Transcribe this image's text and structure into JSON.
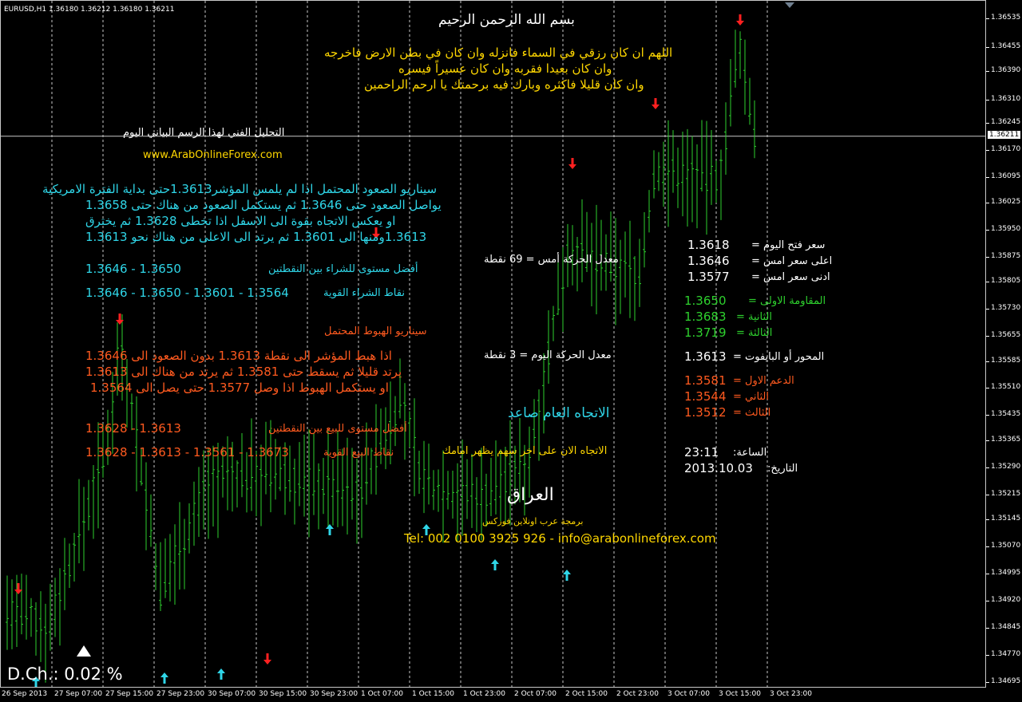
{
  "symbol_label": "EURUSD,H1  1.36180 1.36212 1.36180 1.36211",
  "current_price_label": "1.36211",
  "dch_label": "D.Ch.: 0.02 %",
  "colors": {
    "bg": "#000000",
    "candle": "#2ed12e",
    "grid": "#c8c8c8",
    "sell_arrow": "#ff2020",
    "buy_arrow": "#2fd6e8"
  },
  "chart_data": {
    "type": "candlestick",
    "title": "",
    "symbol": "EURUSD",
    "timeframe": "H1",
    "ylim": [
      1.3469,
      1.3656
    ],
    "y_ticks": [
      "1.36535",
      "1.36455",
      "1.36390",
      "1.36310",
      "1.36245",
      "1.36170",
      "1.36095",
      "1.36025",
      "1.35950",
      "1.35875",
      "1.35805",
      "1.35730",
      "1.35655",
      "1.35585",
      "1.35510",
      "1.35435",
      "1.35365",
      "1.35290",
      "1.35215",
      "1.35145",
      "1.35070",
      "1.34995",
      "1.34920",
      "1.34845",
      "1.34770",
      "1.34695"
    ],
    "x_ticks": [
      "26 Sep 2013",
      "27 Sep 07:00",
      "27 Sep 15:00",
      "27 Sep 23:00",
      "30 Sep 07:00",
      "30 Sep 15:00",
      "30 Sep 23:00",
      "1 Oct 07:00",
      "1 Oct 15:00",
      "1 Oct 23:00",
      "2 Oct 07:00",
      "2 Oct 15:00",
      "2 Oct 23:00",
      "3 Oct 07:00",
      "3 Oct 15:00",
      "3 Oct 23:00"
    ],
    "last_close": 1.36211,
    "grid": true,
    "sell_arrow_count": 7,
    "buy_arrow_count": 8
  },
  "texts": {
    "basmala": "بسم الله الرحمن الرحيم",
    "dua1": "اللهم ان كان رزقي في السماء فانزله وان كان في بطن الارض فاخرجه",
    "dua2": "وان كان بعيدا فقربه وان كان عسيراً فيسره",
    "dua3": "وان كان قليلا فاكثره وبارك فيه برحمتك يا ارحم الراحمين",
    "analysis_title": "التحليل الفني لهذا الرسم البياني اليوم",
    "website": "www.ArabOnlineForex.com",
    "up_line1": "سيناريو الصعود المحتمل      اذا لم يلمس المؤشر1.3613حتى بداية الفترة الامريكية",
    "up_line2": "يواصل الصعود حتى 1.3646 ثم يستكمل الصعود من هناك حتى 1.3658",
    "up_line3": "او يعكس الاتجاه بقوة الى الاسفل اذا تخطى 1.3628 ثم يخترق",
    "up_line4": "1.3613ومنها الى 1.3601 ثم يرتد الى الاعلى من هناك نحو 1.3613",
    "best_buy_label": "أفضل مستوى للشراء بين النقطتين",
    "best_buy_value": "1.3646 - 1.3650",
    "strong_buy_label": "نقاط الشراء القوية",
    "strong_buy_value": "1.3646 - 1.3650 - 1.3601 - 1.3564",
    "down_title": "سيناريو الهبوط المحتمل",
    "down_line1": "اذا هبط المؤشر الى نقطة 1.3613 بدون الصعود الى 1.3646",
    "down_line2": "يرتد قليلا ثم يسقط حتى 1.3581  ثم يرتد من هناك الى 1.3613",
    "down_line3": "او يستكمل الهبوط اذا وصل 1.3577 حتى يصل الى 1.3564",
    "best_sell_label": "أفضل مستوى للبيع بين النقطتين",
    "best_sell_value": "1.3628 - 1.3613",
    "strong_sell_label": "نقاط البيع القوية",
    "strong_sell_value": "1.3628 - 1.3613 - 1.3561 - 1.3673",
    "yesterday_move": "معدل الحركة أمس = 69 نقطة",
    "today_move": "معدل الحركة اليوم = 3 نقطة",
    "general_trend": "الاتجاه العام صاعد",
    "now_trend": "الاتجاه الان على اخر سهم يظهر امامك",
    "iraq": "العراق",
    "programming": "برمجة عرب اونلاين فوركس",
    "contact": "Tel: 002 0100 3925 926 - info@arabonlineforex.com",
    "open_label": "سعر فتح اليوم =",
    "open_value": "1.3618",
    "high_label": "اعلى سعر امس =",
    "high_value": "1.3646",
    "low_label": "ادنى سعر امس =",
    "low_value": "1.3577",
    "r1_label": "المقاومة الاولى =",
    "r1_value": "1.3650",
    "r2_label": "الثانية =",
    "r2_value": "1.3683",
    "r3_label": "الثالثة =",
    "r3_value": "1.3719",
    "pivot_label": "المحور أو البايفوت =",
    "pivot_value": "1.3613",
    "s1_label": "الدعم الاول =",
    "s1_value": "1.3581",
    "s2_label": "الثاني =",
    "s2_value": "1.3544",
    "s3_label": "الثالث =",
    "s3_value": "1.3512",
    "time_label": "الساعة:",
    "time_value": "23:11",
    "date_label": "التاريخ:",
    "date_value": "2013.10.03"
  }
}
